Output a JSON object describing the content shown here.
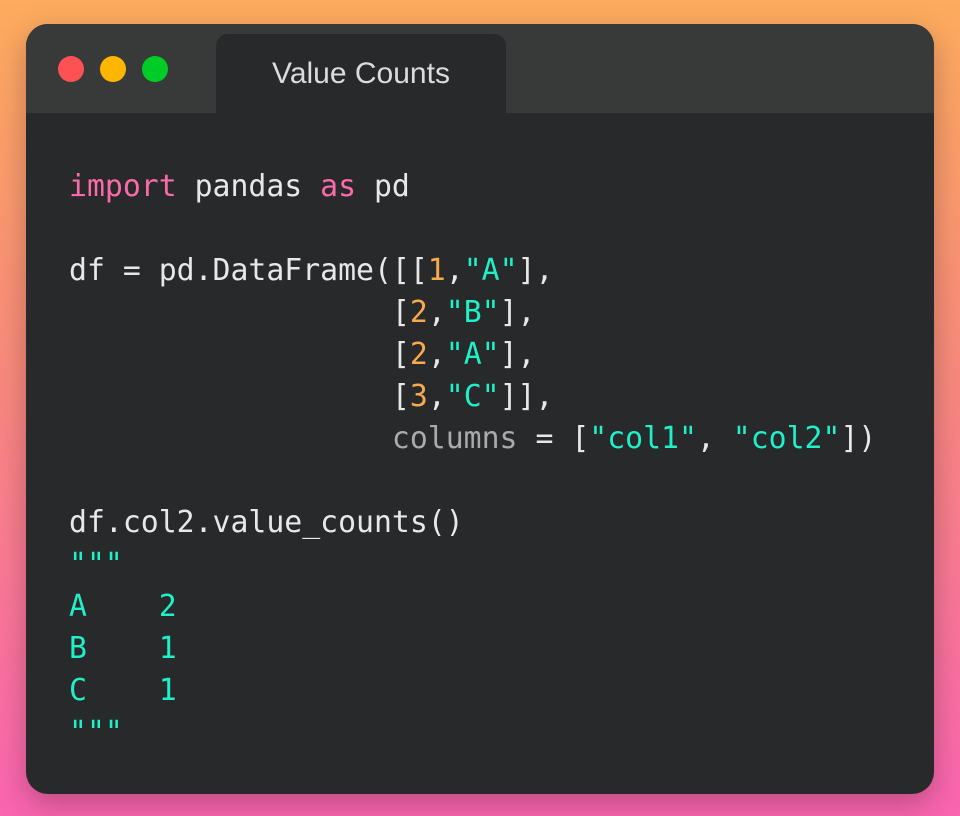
{
  "window": {
    "title": "Value Counts",
    "traffic_lights": {
      "close": "#fe5153",
      "minimize": "#ffb601",
      "maximize": "#00cc27"
    }
  },
  "colors": {
    "keyword": "#fb6aa9",
    "number": "#f7a94f",
    "string": "#1ff0c8",
    "argument": "#aaaaaa",
    "text": "#e8e8e8"
  },
  "code": {
    "lines": [
      [
        [
          "kw",
          "import"
        ],
        [
          "plain",
          " pandas "
        ],
        [
          "kw",
          "as"
        ],
        [
          "plain",
          " pd"
        ]
      ],
      [],
      [
        [
          "plain",
          "df = pd.DataFrame([["
        ],
        [
          "num",
          "1"
        ],
        [
          "plain",
          ","
        ],
        [
          "str",
          "\"A\""
        ],
        [
          "plain",
          "],"
        ]
      ],
      [
        [
          "plain",
          "                  ["
        ],
        [
          "num",
          "2"
        ],
        [
          "plain",
          ","
        ],
        [
          "str",
          "\"B\""
        ],
        [
          "plain",
          "],"
        ]
      ],
      [
        [
          "plain",
          "                  ["
        ],
        [
          "num",
          "2"
        ],
        [
          "plain",
          ","
        ],
        [
          "str",
          "\"A\""
        ],
        [
          "plain",
          "],"
        ]
      ],
      [
        [
          "plain",
          "                  ["
        ],
        [
          "num",
          "3"
        ],
        [
          "plain",
          ","
        ],
        [
          "str",
          "\"C\""
        ],
        [
          "plain",
          "]],"
        ]
      ],
      [
        [
          "plain",
          "                  "
        ],
        [
          "arg",
          "columns"
        ],
        [
          "plain",
          " = ["
        ],
        [
          "str",
          "\"col1\""
        ],
        [
          "plain",
          ", "
        ],
        [
          "str",
          "\"col2\""
        ],
        [
          "plain",
          "])"
        ]
      ],
      [],
      [
        [
          "plain",
          "df.col2.value_counts()"
        ]
      ],
      [
        [
          "str",
          "\"\"\""
        ]
      ],
      [
        [
          "str",
          "A    2"
        ]
      ],
      [
        [
          "str",
          "B    1"
        ]
      ],
      [
        [
          "str",
          "C    1"
        ]
      ],
      [
        [
          "str",
          "\"\"\""
        ]
      ]
    ]
  }
}
